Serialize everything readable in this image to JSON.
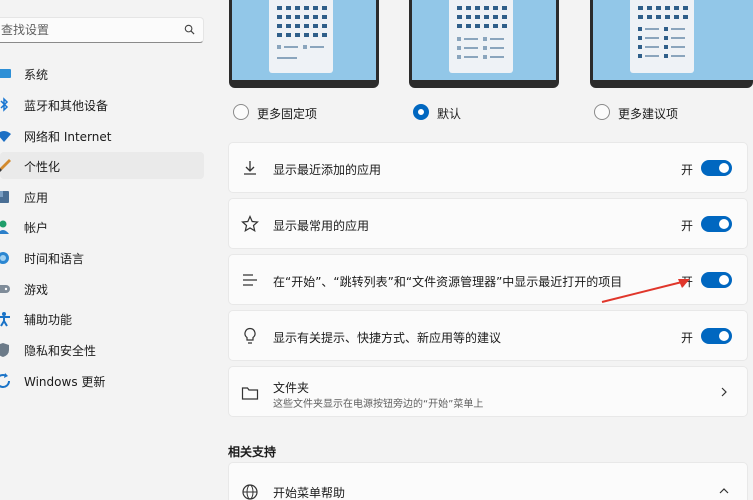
{
  "sidebar": {
    "search_placeholder": "查找设置",
    "items": [
      {
        "label": "系统",
        "icon": "system-icon"
      },
      {
        "label": "蓝牙和其他设备",
        "icon": "bluetooth-icon"
      },
      {
        "label": "网络和 Internet",
        "icon": "wifi-icon"
      },
      {
        "label": "个性化",
        "icon": "brush-icon",
        "active": true
      },
      {
        "label": "应用",
        "icon": "apps-icon"
      },
      {
        "label": "帐户",
        "icon": "account-icon"
      },
      {
        "label": "时间和语言",
        "icon": "globe-clock-icon"
      },
      {
        "label": "游戏",
        "icon": "gamepad-icon"
      },
      {
        "label": "辅助功能",
        "icon": "accessibility-icon"
      },
      {
        "label": "隐私和安全性",
        "icon": "shield-icon"
      },
      {
        "label": "Windows 更新",
        "icon": "update-icon"
      }
    ]
  },
  "layout_options": [
    {
      "label": "更多固定项",
      "selected": false
    },
    {
      "label": "默认",
      "selected": true
    },
    {
      "label": "更多建议项",
      "selected": false
    }
  ],
  "settings": [
    {
      "label": "显示最近添加的应用",
      "state": "开",
      "icon": "download-icon"
    },
    {
      "label": "显示最常用的应用",
      "state": "开",
      "icon": "star-icon"
    },
    {
      "label": "在“开始”、“跳转列表”和“文件资源管理器”中显示最近打开的项目",
      "state": "开",
      "icon": "list-icon"
    },
    {
      "label": "显示有关提示、快捷方式、新应用等的建议",
      "state": "开",
      "icon": "lightbulb-icon"
    }
  ],
  "folders": {
    "title": "文件夹",
    "subtitle": "这些文件夹显示在电源按钮旁边的“开始”菜单上"
  },
  "related": {
    "title": "相关支持",
    "help_label": "开始菜单帮助"
  },
  "colors": {
    "accent": "#0067c0",
    "arrow": "#e0362b"
  }
}
